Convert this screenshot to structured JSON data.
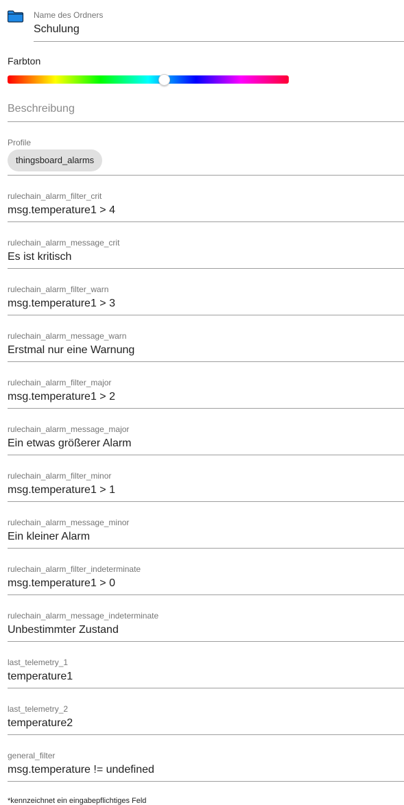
{
  "folder": {
    "label": "Name des Ordners",
    "value": "Schulung",
    "icon": "folder-icon",
    "icon_color": "#1e88e5"
  },
  "hue": {
    "label": "Farbton",
    "value_fraction": 0.555
  },
  "description": {
    "placeholder": "Beschreibung"
  },
  "profile": {
    "label": "Profile",
    "chips": [
      "thingsboard_alarms"
    ]
  },
  "fields": [
    {
      "label": "rulechain_alarm_filter_crit",
      "value": "msg.temperature1 > 4"
    },
    {
      "label": "rulechain_alarm_message_crit",
      "value": "Es ist kritisch"
    },
    {
      "label": "rulechain_alarm_filter_warn",
      "value": "msg.temperature1 > 3"
    },
    {
      "label": "rulechain_alarm_message_warn",
      "value": "Erstmal nur eine Warnung"
    },
    {
      "label": "rulechain_alarm_filter_major",
      "value": "msg.temperature1 > 2"
    },
    {
      "label": "rulechain_alarm_message_major",
      "value": "Ein etwas größerer Alarm"
    },
    {
      "label": "rulechain_alarm_filter_minor",
      "value": "msg.temperature1 > 1"
    },
    {
      "label": "rulechain_alarm_message_minor",
      "value": "Ein kleiner Alarm"
    },
    {
      "label": "rulechain_alarm_filter_indeterminate",
      "value": "msg.temperature1 > 0"
    },
    {
      "label": "rulechain_alarm_message_indeterminate",
      "value": "Unbestimmter Zustand"
    },
    {
      "label": "last_telemetry_1",
      "value": "temperature1"
    },
    {
      "label": "last_telemetry_2",
      "value": "temperature2"
    },
    {
      "label": "general_filter",
      "value": "msg.temperature != undefined"
    }
  ],
  "footnote": "*kennzeichnet ein eingabepflichtiges Feld"
}
